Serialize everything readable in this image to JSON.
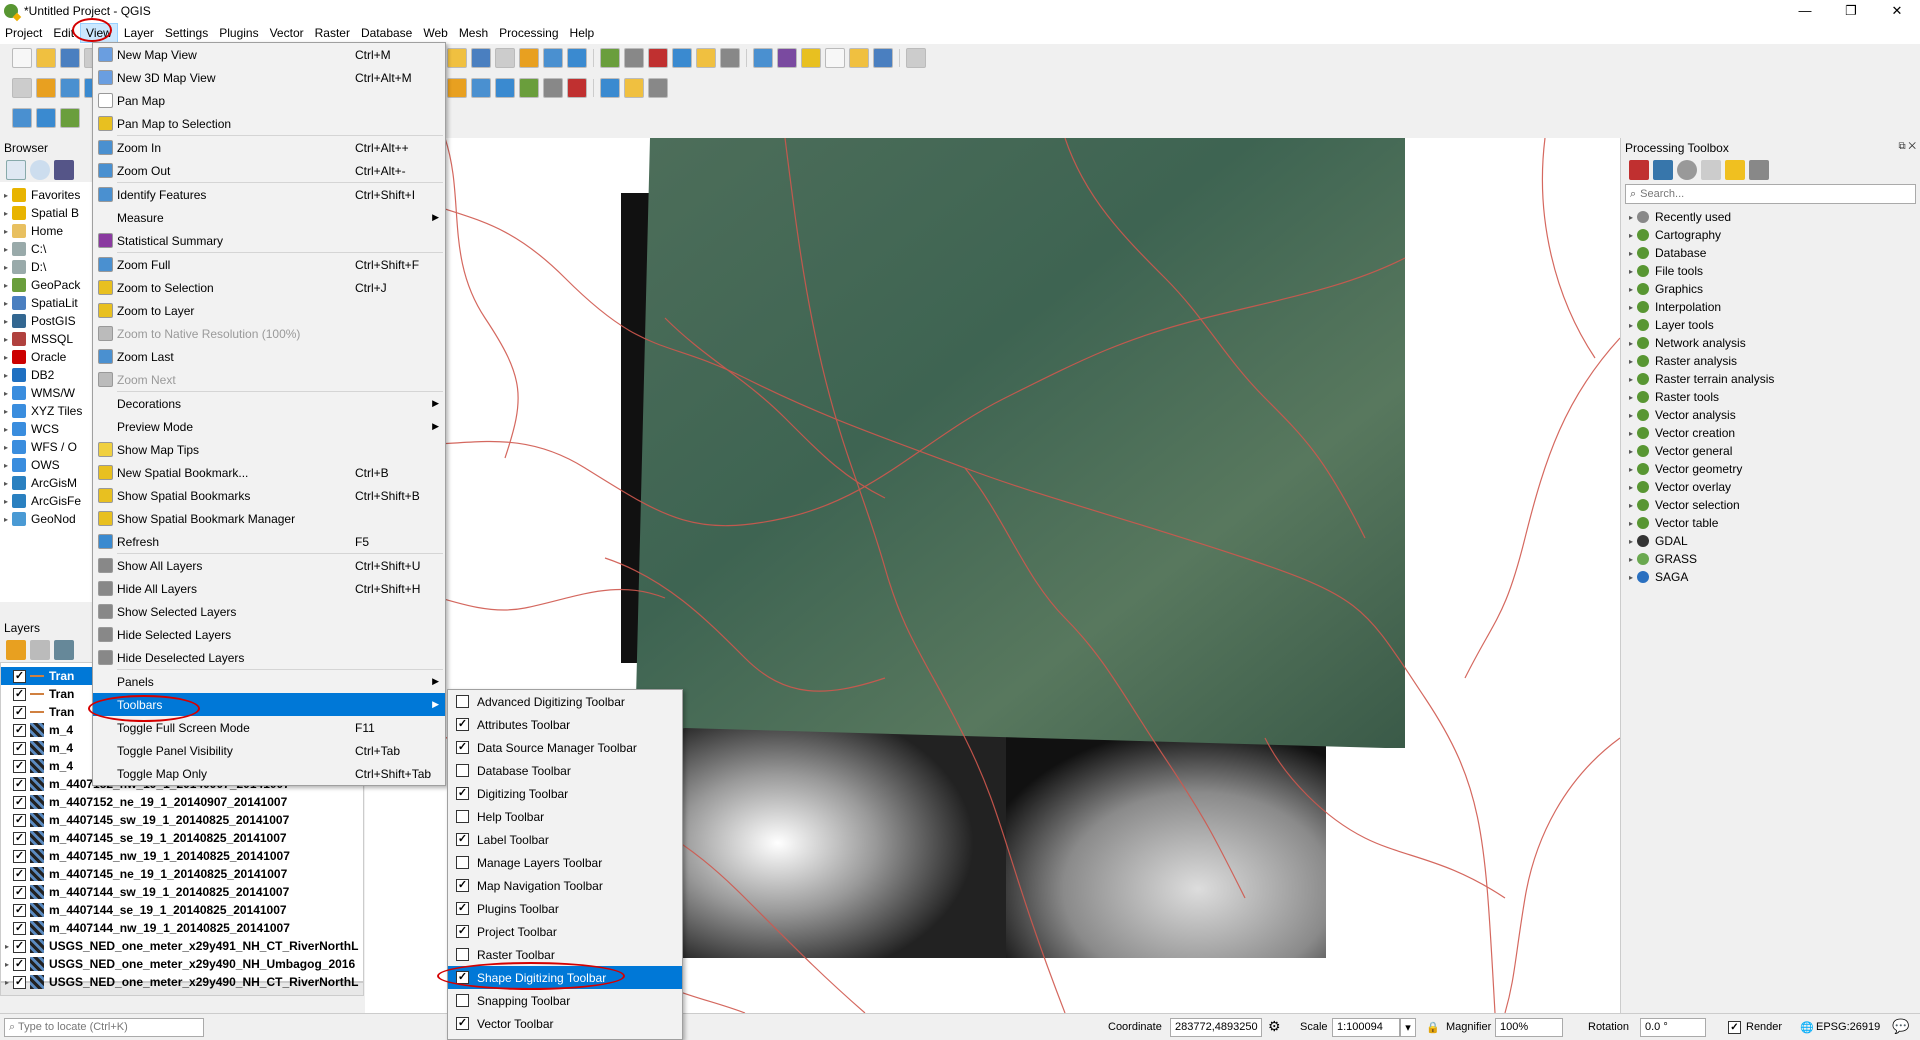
{
  "window": {
    "title": "*Untitled Project - QGIS",
    "min": "—",
    "max": "❐",
    "close": "✕"
  },
  "menubar": [
    "Project",
    "Edit",
    "View",
    "Layer",
    "Settings",
    "Plugins",
    "Vector",
    "Raster",
    "Database",
    "Web",
    "Mesh",
    "Processing",
    "Help"
  ],
  "browser": {
    "title": "Browser",
    "items": [
      {
        "label": "Favorites",
        "color": "#e8b400"
      },
      {
        "label": "Spatial B",
        "color": "#e8b400"
      },
      {
        "label": "Home",
        "color": "#e8c060"
      },
      {
        "label": "C:\\",
        "color": "#9aa"
      },
      {
        "label": "D:\\",
        "color": "#9aa"
      },
      {
        "label": "GeoPack",
        "color": "#6a9e3c"
      },
      {
        "label": "SpatiaLit",
        "color": "#4a7fc0"
      },
      {
        "label": "PostGIS",
        "color": "#336791"
      },
      {
        "label": "MSSQL",
        "color": "#b0413e"
      },
      {
        "label": "Oracle",
        "color": "#c00"
      },
      {
        "label": "DB2",
        "color": "#1f70c1"
      },
      {
        "label": "WMS/W",
        "color": "#3a8dde"
      },
      {
        "label": "XYZ Tiles",
        "color": "#3a8dde"
      },
      {
        "label": "WCS",
        "color": "#3a8dde"
      },
      {
        "label": "WFS / O",
        "color": "#3a8dde"
      },
      {
        "label": "OWS",
        "color": "#3a8dde"
      },
      {
        "label": "ArcGisM",
        "color": "#2a80c0"
      },
      {
        "label": "ArcGisFe",
        "color": "#2a80c0"
      },
      {
        "label": "GeoNod",
        "color": "#4a9ad4"
      }
    ]
  },
  "layers": {
    "title": "Layers",
    "items": [
      {
        "label": "Tran",
        "type": "line",
        "selected": true
      },
      {
        "label": "Tran",
        "type": "line"
      },
      {
        "label": "Tran",
        "type": "line"
      },
      {
        "label": "m_4",
        "type": "raster"
      },
      {
        "label": "m_4",
        "type": "raster"
      },
      {
        "label": "m_4",
        "type": "raster"
      },
      {
        "label": "m_4407152_nw_19_1_20140907_20141007",
        "type": "raster"
      },
      {
        "label": "m_4407152_ne_19_1_20140907_20141007",
        "type": "raster"
      },
      {
        "label": "m_4407145_sw_19_1_20140825_20141007",
        "type": "raster"
      },
      {
        "label": "m_4407145_se_19_1_20140825_20141007",
        "type": "raster"
      },
      {
        "label": "m_4407145_nw_19_1_20140825_20141007",
        "type": "raster"
      },
      {
        "label": "m_4407145_ne_19_1_20140825_20141007",
        "type": "raster"
      },
      {
        "label": "m_4407144_sw_19_1_20140825_20141007",
        "type": "raster"
      },
      {
        "label": "m_4407144_se_19_1_20140825_20141007",
        "type": "raster"
      },
      {
        "label": "m_4407144_nw_19_1_20140825_20141007",
        "type": "raster"
      },
      {
        "label": "USGS_NED_one_meter_x29y491_NH_CT_RiverNorthL",
        "type": "raster",
        "expand": true
      },
      {
        "label": "USGS_NED_one_meter_x29y490_NH_Umbagog_2016",
        "type": "raster",
        "expand": true
      },
      {
        "label": "USGS_NED_one_meter_x29y490_NH_CT_RiverNorthL",
        "type": "raster",
        "expand": true
      }
    ]
  },
  "locator": {
    "placeholder": "Type to locate (Ctrl+K)"
  },
  "view_menu": [
    {
      "label": "New Map View",
      "shortcut": "Ctrl+M",
      "icon": "#6a9ee0"
    },
    {
      "label": "New 3D Map View",
      "shortcut": "Ctrl+Alt+M",
      "icon": "#6a9ee0"
    },
    {
      "label": "Pan Map",
      "shortcut": "",
      "icon": "#ffffff"
    },
    {
      "label": "Pan Map to Selection",
      "shortcut": "",
      "icon": "#e8c020"
    },
    {
      "sep": true
    },
    {
      "label": "Zoom In",
      "shortcut": "Ctrl+Alt++",
      "icon": "#4a90d0"
    },
    {
      "label": "Zoom Out",
      "shortcut": "Ctrl+Alt+-",
      "icon": "#4a90d0"
    },
    {
      "sep": true
    },
    {
      "label": "Identify Features",
      "shortcut": "Ctrl+Shift+I",
      "icon": "#4a90d0"
    },
    {
      "label": "Measure",
      "shortcut": "",
      "submenu": true
    },
    {
      "label": "Statistical Summary",
      "shortcut": "",
      "icon": "#8a3aa0"
    },
    {
      "sep": true
    },
    {
      "label": "Zoom Full",
      "shortcut": "Ctrl+Shift+F",
      "icon": "#4a90d0"
    },
    {
      "label": "Zoom to Selection",
      "shortcut": "Ctrl+J",
      "icon": "#e8c020"
    },
    {
      "label": "Zoom to Layer",
      "shortcut": "",
      "icon": "#e8c020"
    },
    {
      "label": "Zoom to Native Resolution (100%)",
      "shortcut": "",
      "disabled": true,
      "icon": "#bbbbbb"
    },
    {
      "label": "Zoom Last",
      "shortcut": "",
      "icon": "#4a90d0"
    },
    {
      "label": "Zoom Next",
      "shortcut": "",
      "disabled": true,
      "icon": "#bbbbbb"
    },
    {
      "sep": true
    },
    {
      "label": "Decorations",
      "shortcut": "",
      "submenu": true
    },
    {
      "label": "Preview Mode",
      "shortcut": "",
      "submenu": true
    },
    {
      "label": "Show Map Tips",
      "shortcut": "",
      "icon": "#f0d040"
    },
    {
      "label": "New Spatial Bookmark...",
      "shortcut": "Ctrl+B",
      "icon": "#e8c020"
    },
    {
      "label": "Show Spatial Bookmarks",
      "shortcut": "Ctrl+Shift+B",
      "icon": "#e8c020"
    },
    {
      "label": "Show Spatial Bookmark Manager",
      "shortcut": "",
      "icon": "#e8c020"
    },
    {
      "label": "Refresh",
      "shortcut": "F5",
      "icon": "#3a8ad0"
    },
    {
      "sep": true
    },
    {
      "label": "Show All Layers",
      "shortcut": "Ctrl+Shift+U",
      "icon": "#888888"
    },
    {
      "label": "Hide All Layers",
      "shortcut": "Ctrl+Shift+H",
      "icon": "#888888"
    },
    {
      "label": "Show Selected Layers",
      "shortcut": "",
      "icon": "#888888"
    },
    {
      "label": "Hide Selected Layers",
      "shortcut": "",
      "icon": "#888888"
    },
    {
      "label": "Hide Deselected Layers",
      "shortcut": "",
      "icon": "#888888"
    },
    {
      "sep": true
    },
    {
      "label": "Panels",
      "shortcut": "",
      "submenu": true
    },
    {
      "label": "Toolbars",
      "shortcut": "",
      "submenu": true,
      "highlight": true
    },
    {
      "label": "Toggle Full Screen Mode",
      "shortcut": "F11"
    },
    {
      "label": "Toggle Panel Visibility",
      "shortcut": "Ctrl+Tab"
    },
    {
      "label": "Toggle Map Only",
      "shortcut": "Ctrl+Shift+Tab"
    }
  ],
  "toolbars_submenu": [
    {
      "label": "Advanced Digitizing Toolbar",
      "checked": false
    },
    {
      "label": "Attributes Toolbar",
      "checked": true
    },
    {
      "label": "Data Source Manager Toolbar",
      "checked": true
    },
    {
      "label": "Database Toolbar",
      "checked": false
    },
    {
      "label": "Digitizing Toolbar",
      "checked": true
    },
    {
      "label": "Help Toolbar",
      "checked": false
    },
    {
      "label": "Label Toolbar",
      "checked": true
    },
    {
      "label": "Manage Layers Toolbar",
      "checked": false
    },
    {
      "label": "Map Navigation Toolbar",
      "checked": true
    },
    {
      "label": "Plugins Toolbar",
      "checked": true
    },
    {
      "label": "Project Toolbar",
      "checked": true
    },
    {
      "label": "Raster Toolbar",
      "checked": false
    },
    {
      "label": "Shape Digitizing Toolbar",
      "checked": true,
      "highlight": true
    },
    {
      "label": "Snapping Toolbar",
      "checked": false
    },
    {
      "label": "Vector Toolbar",
      "checked": true
    }
  ],
  "processing": {
    "title": "Processing Toolbox",
    "search_placeholder": "Search...",
    "items": [
      {
        "label": "Recently used",
        "icon": "clock"
      },
      {
        "label": "Cartography",
        "icon": "q"
      },
      {
        "label": "Database",
        "icon": "q"
      },
      {
        "label": "File tools",
        "icon": "q"
      },
      {
        "label": "Graphics",
        "icon": "q"
      },
      {
        "label": "Interpolation",
        "icon": "q"
      },
      {
        "label": "Layer tools",
        "icon": "q"
      },
      {
        "label": "Network analysis",
        "icon": "q"
      },
      {
        "label": "Raster analysis",
        "icon": "q"
      },
      {
        "label": "Raster terrain analysis",
        "icon": "q"
      },
      {
        "label": "Raster tools",
        "icon": "q"
      },
      {
        "label": "Vector analysis",
        "icon": "q"
      },
      {
        "label": "Vector creation",
        "icon": "q"
      },
      {
        "label": "Vector general",
        "icon": "q"
      },
      {
        "label": "Vector geometry",
        "icon": "q"
      },
      {
        "label": "Vector overlay",
        "icon": "q"
      },
      {
        "label": "Vector selection",
        "icon": "q"
      },
      {
        "label": "Vector table",
        "icon": "q"
      },
      {
        "label": "GDAL",
        "icon": "gdal"
      },
      {
        "label": "GRASS",
        "icon": "grass"
      },
      {
        "label": "SAGA",
        "icon": "saga"
      }
    ]
  },
  "statusbar": {
    "coordinate_label": "Coordinate",
    "coordinate_value": "283772,4893250",
    "scale_label": "Scale",
    "scale_value": "1:100094",
    "magnifier_label": "Magnifier",
    "magnifier_value": "100%",
    "rotation_label": "Rotation",
    "rotation_value": "0.0 °",
    "render_label": "Render",
    "crs_label": "EPSG:26919"
  },
  "colors": {
    "highlight": "#0078d7",
    "annotation": "#d40000",
    "roads": "#d0584e"
  }
}
